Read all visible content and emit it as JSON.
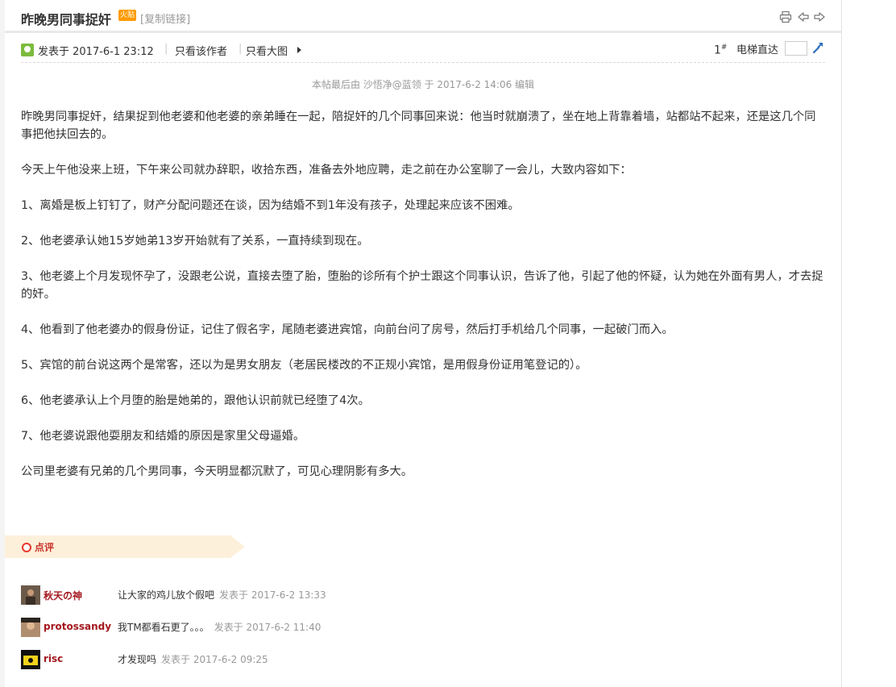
{
  "thread": {
    "title": "昨晚男同事捉奸",
    "hot_badge": "火贴",
    "copy_link": "[复制链接]"
  },
  "post": {
    "posted": "发表于 2017-6-1 23:12",
    "sep": "|",
    "only_author": "只看该作者",
    "big_image": "只看大图",
    "floor_num": "1",
    "floor_sup": "#",
    "elevator_label": "电梯直达",
    "edit_note": "本帖最后由 沙悟净@蓝领 于 2017-6-2 14:06 编辑",
    "paragraphs": [
      "昨晚男同事捉奸，结果捉到他老婆和他老婆的亲弟睡在一起，陪捉奸的几个同事回来说：他当时就崩溃了，坐在地上背靠着墙，站都站不起来，还是这几个同事把他扶回去的。",
      "今天上午他没来上班，下午来公司就办辞职，收拾东西，准备去外地应聘，走之前在办公室聊了一会儿，大致内容如下：",
      "1、离婚是板上钉钉了，财产分配问题还在谈，因为结婚不到1年没有孩子，处理起来应该不困难。",
      "2、他老婆承认她15岁她弟13岁开始就有了关系，一直持续到现在。",
      "3、他老婆上个月发现怀孕了，没跟老公说，直接去堕了胎，堕胎的诊所有个护士跟这个同事认识，告诉了他，引起了他的怀疑，认为她在外面有男人，才去捉的奸。",
      "4、他看到了他老婆办的假身份证，记住了假名字，尾随老婆进宾馆，向前台问了房号，然后打手机给几个同事，一起破门而入。",
      "5、宾馆的前台说这两个是常客，还以为是男女朋友（老居民楼改的不正规小宾馆，是用假身份证用笔登记的）。",
      "6、他老婆承认上个月堕的胎是她弟的，跟他认识前就已经堕了4次。",
      "7、他老婆说跟他耍朋友和结婚的原因是家里父母逼婚。",
      "公司里老婆有兄弟的几个男同事，今天明显都沉默了，可见心理阴影有多大。"
    ]
  },
  "comments": {
    "header": "点评",
    "items": [
      {
        "user": "秋天の神",
        "text": "让大家的鸡儿放个假吧",
        "time": "发表于 2017-6-2 13:33"
      },
      {
        "user": "protossandy",
        "text": "我TM都看石更了。。。",
        "time": "发表于 2017-6-2 11:40"
      },
      {
        "user": "risc",
        "text": "才发现吗",
        "time": "发表于 2017-6-2 09:25"
      }
    ]
  },
  "colors": {
    "accent_red": "#a4181f",
    "comment_header_bg": "#fdf0db",
    "hot_badge": "#ff9b00"
  }
}
